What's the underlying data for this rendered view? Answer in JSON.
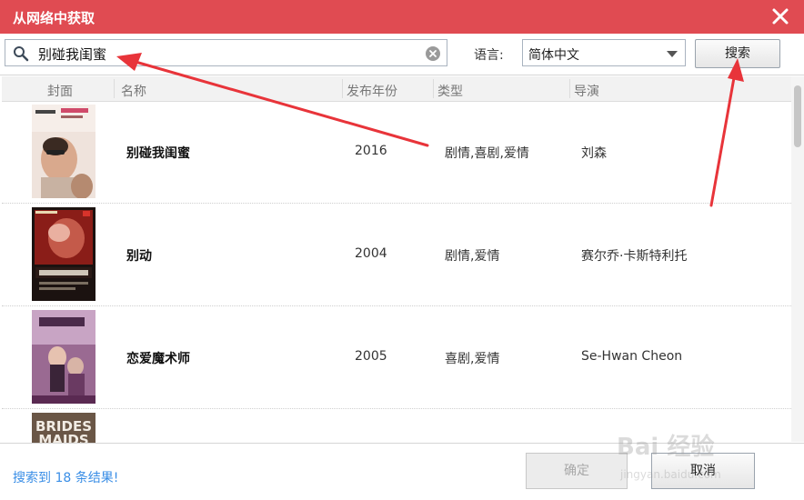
{
  "window": {
    "title": "从网络中获取"
  },
  "search": {
    "value": "别碰我闺蜜",
    "placeholder": ""
  },
  "language": {
    "label": "语言:",
    "selected": "简体中文"
  },
  "buttons": {
    "search": "搜索",
    "ok": "确定",
    "cancel": "取消"
  },
  "table": {
    "columns": [
      "封面",
      "名称",
      "发布年份",
      "类型",
      "导演"
    ],
    "rows": [
      {
        "name": "别碰我闺蜜",
        "year": "2016",
        "genre": "剧情,喜剧,爱情",
        "director": "刘森",
        "cover_color": "#e7d6cc"
      },
      {
        "name": "别动",
        "year": "2004",
        "genre": "剧情,爱情",
        "director": "赛尔乔·卡斯特利托",
        "cover_color": "#7a1a16"
      },
      {
        "name": "恋爱魔术师",
        "year": "2005",
        "genre": "喜剧,爱情",
        "director": "Se-Hwan Cheon",
        "cover_color": "#8f5f86"
      },
      {
        "name": "",
        "year": "",
        "genre": "",
        "director": "",
        "cover_color": "#5a4636"
      }
    ],
    "row4_cover_text": [
      "BRIDES",
      "MAIDS"
    ]
  },
  "status": {
    "result_text": "搜索到 18 条结果!"
  },
  "watermark": {
    "text": "Bai 经验",
    "url": "jingyan.baidu.com"
  },
  "colors": {
    "titlebar": "#e04b52",
    "accent_text": "#3a8ee6",
    "annotation_arrow": "#e8343a"
  }
}
